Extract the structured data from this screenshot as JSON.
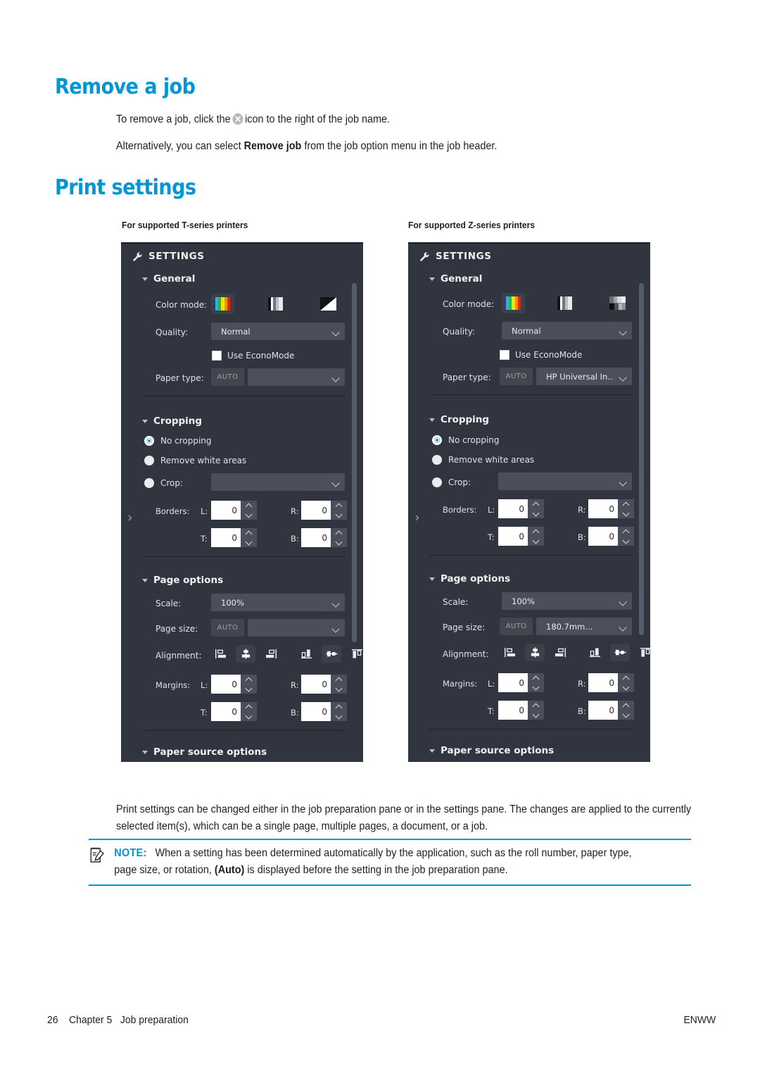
{
  "document": {
    "headings": {
      "remove_a_job": "Remove a job",
      "print_settings": "Print settings"
    },
    "paragraphs": {
      "remove_instruction_prefix": "To remove a job, click the",
      "remove_instruction_suffix": "icon to the right of the job name.",
      "alternative_prefix": "Alternatively, you can select",
      "alternative_bold": "Remove job",
      "alternative_suffix": "from the job option menu in the job header.",
      "print_settings_description": "Print settings can be changed either in the job preparation pane or in the settings pane. The changes are applied to the currently selected item(s), which can be a single page, multiple pages, a document, or a job."
    },
    "note": {
      "label": "NOTE:",
      "text_before_bold": "When a setting has been determined automatically by the application, such as the roll number, paper type, page size, or rotation,",
      "bold": "(Auto)",
      "text_after_bold": "is displayed before the setting in the job preparation pane.",
      "icon": "note-pencil-icon",
      "accent_color": "#0096d6"
    },
    "footer": {
      "page_number": "26",
      "chapter": "Chapter 5",
      "chapter_title": "Job preparation",
      "locale": "ENWW"
    },
    "accent_color": "#0096d6",
    "text_color": "#231f20"
  },
  "figures": {
    "left": {
      "caption": "For supported T-series printers",
      "panel": {
        "header": {
          "icon": "wrench-icon",
          "title": "SETTINGS"
        },
        "sections": {
          "general": {
            "label": "General",
            "color_mode": {
              "label": "Color mode:",
              "options": [
                "color-swatch-icon",
                "grayscale-swatch-icon",
                "black-white-swatch-icon"
              ],
              "selected_index": 0
            },
            "quality": {
              "label": "Quality:",
              "value": "Normal"
            },
            "econo_mode": {
              "label": "Use EconoMode",
              "checked": false
            },
            "paper_type": {
              "label": "Paper type:",
              "auto_chip": "AUTO",
              "value": ""
            }
          },
          "cropping": {
            "label": "Cropping",
            "options": [
              {
                "label": "No cropping",
                "selected": true
              },
              {
                "label": "Remove white areas",
                "selected": false
              },
              {
                "label": "Crop:",
                "selected": false
              }
            ],
            "crop_dropdown_value": "",
            "borders": {
              "label": "Borders:",
              "fields": [
                {
                  "key": "L:",
                  "value": "0"
                },
                {
                  "key": "R:",
                  "value": "0"
                },
                {
                  "key": "T:",
                  "value": "0"
                },
                {
                  "key": "B:",
                  "value": "0"
                }
              ]
            }
          },
          "page_options": {
            "label": "Page options",
            "scale": {
              "label": "Scale:",
              "value": "100%"
            },
            "page_size": {
              "label": "Page size:",
              "auto_chip": "AUTO",
              "value": ""
            },
            "alignment": {
              "label": "Alignment:",
              "horizontal": [
                "align-left-icon",
                "align-center-icon",
                "align-right-icon"
              ],
              "horizontal_selected_index": 1,
              "vertical": [
                "align-bottom-icon",
                "align-middle-icon",
                "align-top-icon"
              ],
              "vertical_selected_index": 1
            },
            "margins": {
              "label": "Margins:",
              "fields": [
                {
                  "key": "L:",
                  "value": "0"
                },
                {
                  "key": "R:",
                  "value": "0"
                },
                {
                  "key": "T:",
                  "value": "0"
                },
                {
                  "key": "B:",
                  "value": "0"
                }
              ]
            }
          },
          "paper_source": {
            "label": "Paper source options"
          }
        }
      }
    },
    "right": {
      "caption": "For supported Z-series printers",
      "panel": {
        "header": {
          "icon": "wrench-icon",
          "title": "SETTINGS"
        },
        "sections": {
          "general": {
            "label": "General",
            "color_mode": {
              "label": "Color mode:",
              "options": [
                "color-swatch-icon",
                "grayscale-swatch-icon",
                "halftone-swatch-icon"
              ],
              "selected_index": 0
            },
            "quality": {
              "label": "Quality:",
              "value": "Normal"
            },
            "econo_mode": {
              "label": "Use EconoMode",
              "checked": false
            },
            "paper_type": {
              "label": "Paper type:",
              "auto_chip": "AUTO",
              "value": "HP Universal In..."
            }
          },
          "cropping": {
            "label": "Cropping",
            "options": [
              {
                "label": "No cropping",
                "selected": true
              },
              {
                "label": "Remove white areas",
                "selected": false
              },
              {
                "label": "Crop:",
                "selected": false
              }
            ],
            "crop_dropdown_value": "",
            "borders": {
              "label": "Borders:",
              "fields": [
                {
                  "key": "L:",
                  "value": "0"
                },
                {
                  "key": "R:",
                  "value": "0"
                },
                {
                  "key": "T:",
                  "value": "0"
                },
                {
                  "key": "B:",
                  "value": "0"
                }
              ]
            }
          },
          "page_options": {
            "label": "Page options",
            "scale": {
              "label": "Scale:",
              "value": "100%"
            },
            "page_size": {
              "label": "Page size:",
              "auto_chip": "AUTO",
              "value": "180.7mm..."
            },
            "alignment": {
              "label": "Alignment:",
              "horizontal": [
                "align-left-icon",
                "align-center-icon",
                "align-right-icon"
              ],
              "horizontal_selected_index": 1,
              "vertical": [
                "align-bottom-icon",
                "align-middle-icon",
                "align-top-icon"
              ],
              "vertical_selected_index": 1
            },
            "margins": {
              "label": "Margins:",
              "fields": [
                {
                  "key": "L:",
                  "value": "0"
                },
                {
                  "key": "R:",
                  "value": "0"
                },
                {
                  "key": "T:",
                  "value": "0"
                },
                {
                  "key": "B:",
                  "value": "0"
                }
              ]
            }
          },
          "paper_source": {
            "label": "Paper source options"
          }
        }
      }
    },
    "panel_colors": {
      "background": "#31353f",
      "control": "#4a4f5b",
      "selected": "#3b404b",
      "radio_accent": "#0a84d8",
      "text": "#e7e9ec"
    }
  }
}
